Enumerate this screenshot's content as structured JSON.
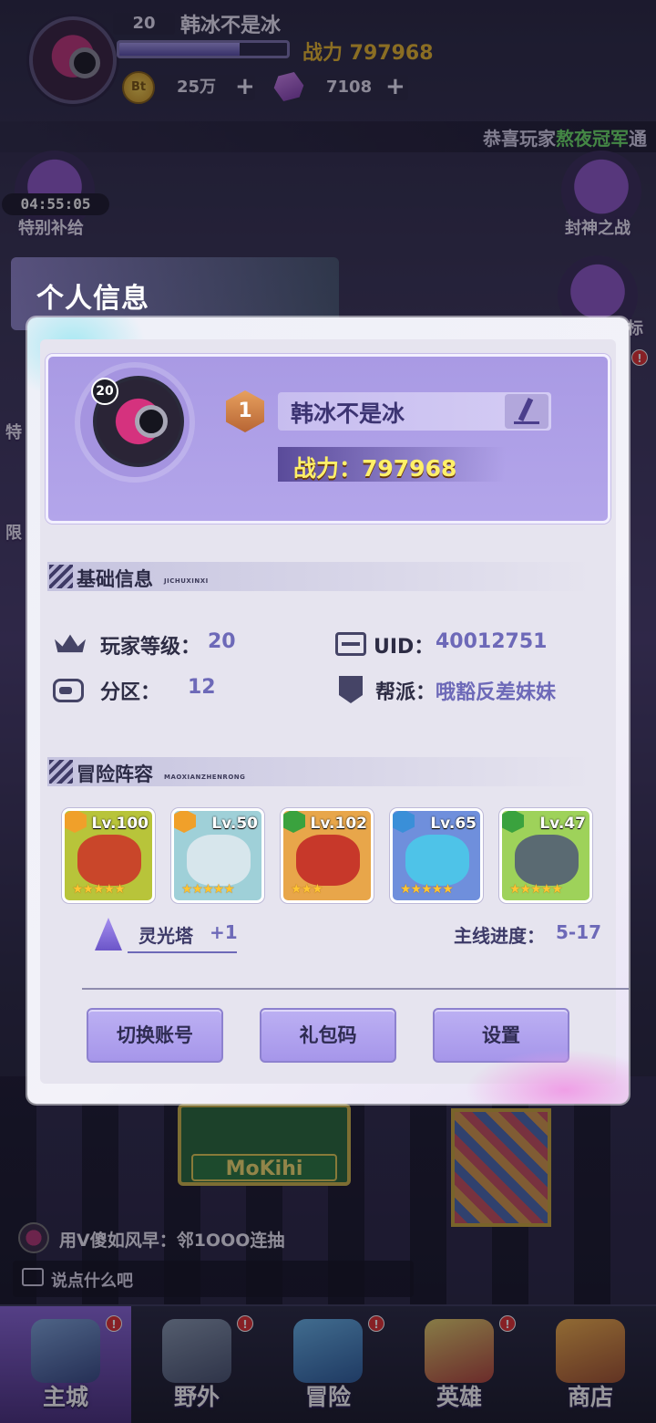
{
  "top_hud": {
    "level": "20",
    "player_name": "韩冰不是冰",
    "exp_progress": 0.72,
    "power_label": "战力 797968",
    "coin_icon_text": "Bt",
    "coins": "25万",
    "gems": "7108",
    "plus": "+"
  },
  "marquee": {
    "prefix": "恭喜玩家",
    "highlight": "熬夜冠军",
    "suffix": "通"
  },
  "side_events": {
    "left_timer": "04:55:05",
    "left_label": "特别补给",
    "right_label": "封神之战",
    "right_partial_label": "标",
    "left_partial_label": "特",
    "left_partial_label_2": "限",
    "alert": "!"
  },
  "dialog": {
    "title": "个人信息",
    "profile": {
      "level": "20",
      "rank": "1",
      "name": "韩冰不是冰",
      "power": "战力：797968"
    },
    "basic_section": {
      "title": "基础信息",
      "subtitle": "JICHUXINXI",
      "player_level_label": "玩家等级：",
      "player_level_value": "20",
      "uid_label": "UID：",
      "uid_value": "40012751",
      "zone_label": "分区：",
      "zone_value": "12",
      "guild_label": "帮派：",
      "guild_value": "哦豁反差妹妹"
    },
    "lineup_section": {
      "title": "冒险阵容",
      "subtitle": "MAOXIANZHENRONG",
      "heroes": [
        {
          "level": "Lv.100",
          "stars": "★★★★★",
          "element_color": "#f0a02a",
          "bg_color": "#b8c43a",
          "face_color": "#c9462a"
        },
        {
          "level": "Lv.50",
          "stars": "★★★★★",
          "element_color": "#f0a02a",
          "bg_color": "#9fd0d8",
          "face_color": "#d7e6ec"
        },
        {
          "level": "Lv.102",
          "stars": "★★★",
          "element_color": "#3aa23e",
          "bg_color": "#e8a64a",
          "face_color": "#c7382a"
        },
        {
          "level": "Lv.65",
          "stars": "★★★★★",
          "element_color": "#3a8fd8",
          "bg_color": "#6f8fdc",
          "face_color": "#4ec3e8"
        },
        {
          "level": "Lv.47",
          "stars": "★★★★★",
          "element_color": "#3aa23e",
          "bg_color": "#9ed25a",
          "face_color": "#5a6a72"
        }
      ],
      "tower_label": "灵光塔",
      "tower_value": "+1",
      "main_progress_label": "主线进度：",
      "main_progress_value": "5-17"
    },
    "buttons": {
      "switch_account": "切换账号",
      "gift_code": "礼包码",
      "settings": "设置"
    }
  },
  "chat": {
    "last_message": "用V傻如风早：邻1OOO连抽",
    "input_placeholder": "说点什么吧"
  },
  "background": {
    "shop_sign": "MoKihi"
  },
  "bottom_nav": [
    {
      "label": "主城"
    },
    {
      "label": "野外"
    },
    {
      "label": "冒险"
    },
    {
      "label": "英雄"
    },
    {
      "label": "商店"
    }
  ]
}
